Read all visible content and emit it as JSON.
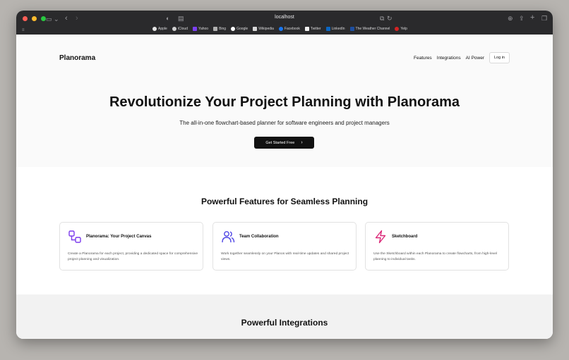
{
  "browser": {
    "url": "localhost",
    "bookmarks": [
      {
        "label": "Apple",
        "icon": "apple-icon",
        "color": "#e5e5e5"
      },
      {
        "label": "iCloud",
        "icon": "cloud-icon",
        "color": "#d0d0d0"
      },
      {
        "label": "Yahoo",
        "icon": "yahoo-icon",
        "color": "#7b3ff2"
      },
      {
        "label": "Bing",
        "icon": "bing-icon",
        "color": "#b0b0b0"
      },
      {
        "label": "Google",
        "icon": "google-icon",
        "color": "#ffffff"
      },
      {
        "label": "Wikipedia",
        "icon": "wikipedia-icon",
        "color": "#d8d8d8"
      },
      {
        "label": "Facebook",
        "icon": "facebook-icon",
        "color": "#1877f2"
      },
      {
        "label": "Twitter",
        "icon": "x-icon",
        "color": "#f0f0f0"
      },
      {
        "label": "LinkedIn",
        "icon": "linkedin-icon",
        "color": "#0a66c2"
      },
      {
        "label": "The Weather Channel",
        "icon": "weather-icon",
        "color": "#1e4fa0"
      },
      {
        "label": "Yelp",
        "icon": "yelp-icon",
        "color": "#d32323"
      }
    ]
  },
  "nav": {
    "logo": "Planorama",
    "links": [
      "Features",
      "Integrations",
      "AI Power"
    ],
    "login": "Log in"
  },
  "hero": {
    "title": "Revolutionize Your Project Planning with Planorama",
    "subtitle": "The all-in-one flowchart-based planner for software engineers and project managers",
    "cta": "Get Started Free"
  },
  "features": {
    "title": "Powerful Features for Seamless Planning",
    "cards": [
      {
        "title": "Planorama: Your Project Canvas",
        "desc": "Create a Planorama for each project, providing a dedicated space for comprehensive project planning and visualization.",
        "icon": "canvas-icon",
        "color": "#7c3aed"
      },
      {
        "title": "Team Collaboration",
        "desc": "Work together seamlessly on your Planos with real-time updates and shared project views.",
        "icon": "users-icon",
        "color": "#4f46e5"
      },
      {
        "title": "Sketchboard",
        "desc": "Use the Sketchboard within each Planorama to create flowcharts, from high-level planning to individual tasks.",
        "icon": "lightning-icon",
        "color": "#db2777"
      }
    ]
  },
  "integrations": {
    "title": "Powerful Integrations"
  }
}
